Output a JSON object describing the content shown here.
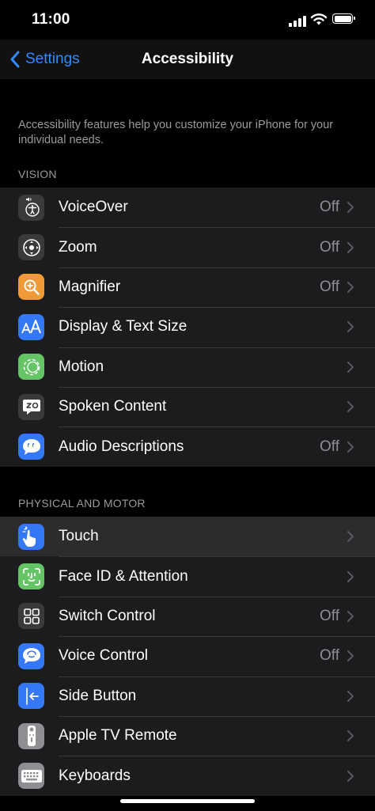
{
  "status_bar": {
    "time": "11:00"
  },
  "nav": {
    "back_label": "Settings",
    "title": "Accessibility"
  },
  "intro": "Accessibility features help you customize your iPhone for your individual needs.",
  "sections": [
    {
      "header": "VISION",
      "rows": [
        {
          "label": "VoiceOver",
          "value": "Off",
          "icon": "voiceover-icon",
          "icon_color": "#3a3a3c"
        },
        {
          "label": "Zoom",
          "value": "Off",
          "icon": "zoom-icon",
          "icon_color": "#3a3a3c"
        },
        {
          "label": "Magnifier",
          "value": "Off",
          "icon": "magnifier-icon",
          "icon_color": "#f09a37"
        },
        {
          "label": "Display & Text Size",
          "value": "",
          "icon": "text-size-icon",
          "icon_color": "#3478f6"
        },
        {
          "label": "Motion",
          "value": "",
          "icon": "motion-icon",
          "icon_color": "#65c466"
        },
        {
          "label": "Spoken Content",
          "value": "",
          "icon": "spoken-content-icon",
          "icon_color": "#3a3a3c"
        },
        {
          "label": "Audio Descriptions",
          "value": "Off",
          "icon": "audio-descriptions-icon",
          "icon_color": "#3478f6"
        }
      ]
    },
    {
      "header": "PHYSICAL AND MOTOR",
      "rows": [
        {
          "label": "Touch",
          "value": "",
          "icon": "touch-icon",
          "icon_color": "#3478f6"
        },
        {
          "label": "Face ID & Attention",
          "value": "",
          "icon": "face-id-icon",
          "icon_color": "#65c466"
        },
        {
          "label": "Switch Control",
          "value": "Off",
          "icon": "switch-control-icon",
          "icon_color": "#3a3a3c"
        },
        {
          "label": "Voice Control",
          "value": "Off",
          "icon": "voice-control-icon",
          "icon_color": "#3478f6"
        },
        {
          "label": "Side Button",
          "value": "",
          "icon": "side-button-icon",
          "icon_color": "#3478f6"
        },
        {
          "label": "Apple TV Remote",
          "value": "",
          "icon": "apple-tv-remote-icon",
          "icon_color": "#8e8e93"
        },
        {
          "label": "Keyboards",
          "value": "",
          "icon": "keyboard-icon",
          "icon_color": "#8e8e93"
        }
      ]
    }
  ]
}
